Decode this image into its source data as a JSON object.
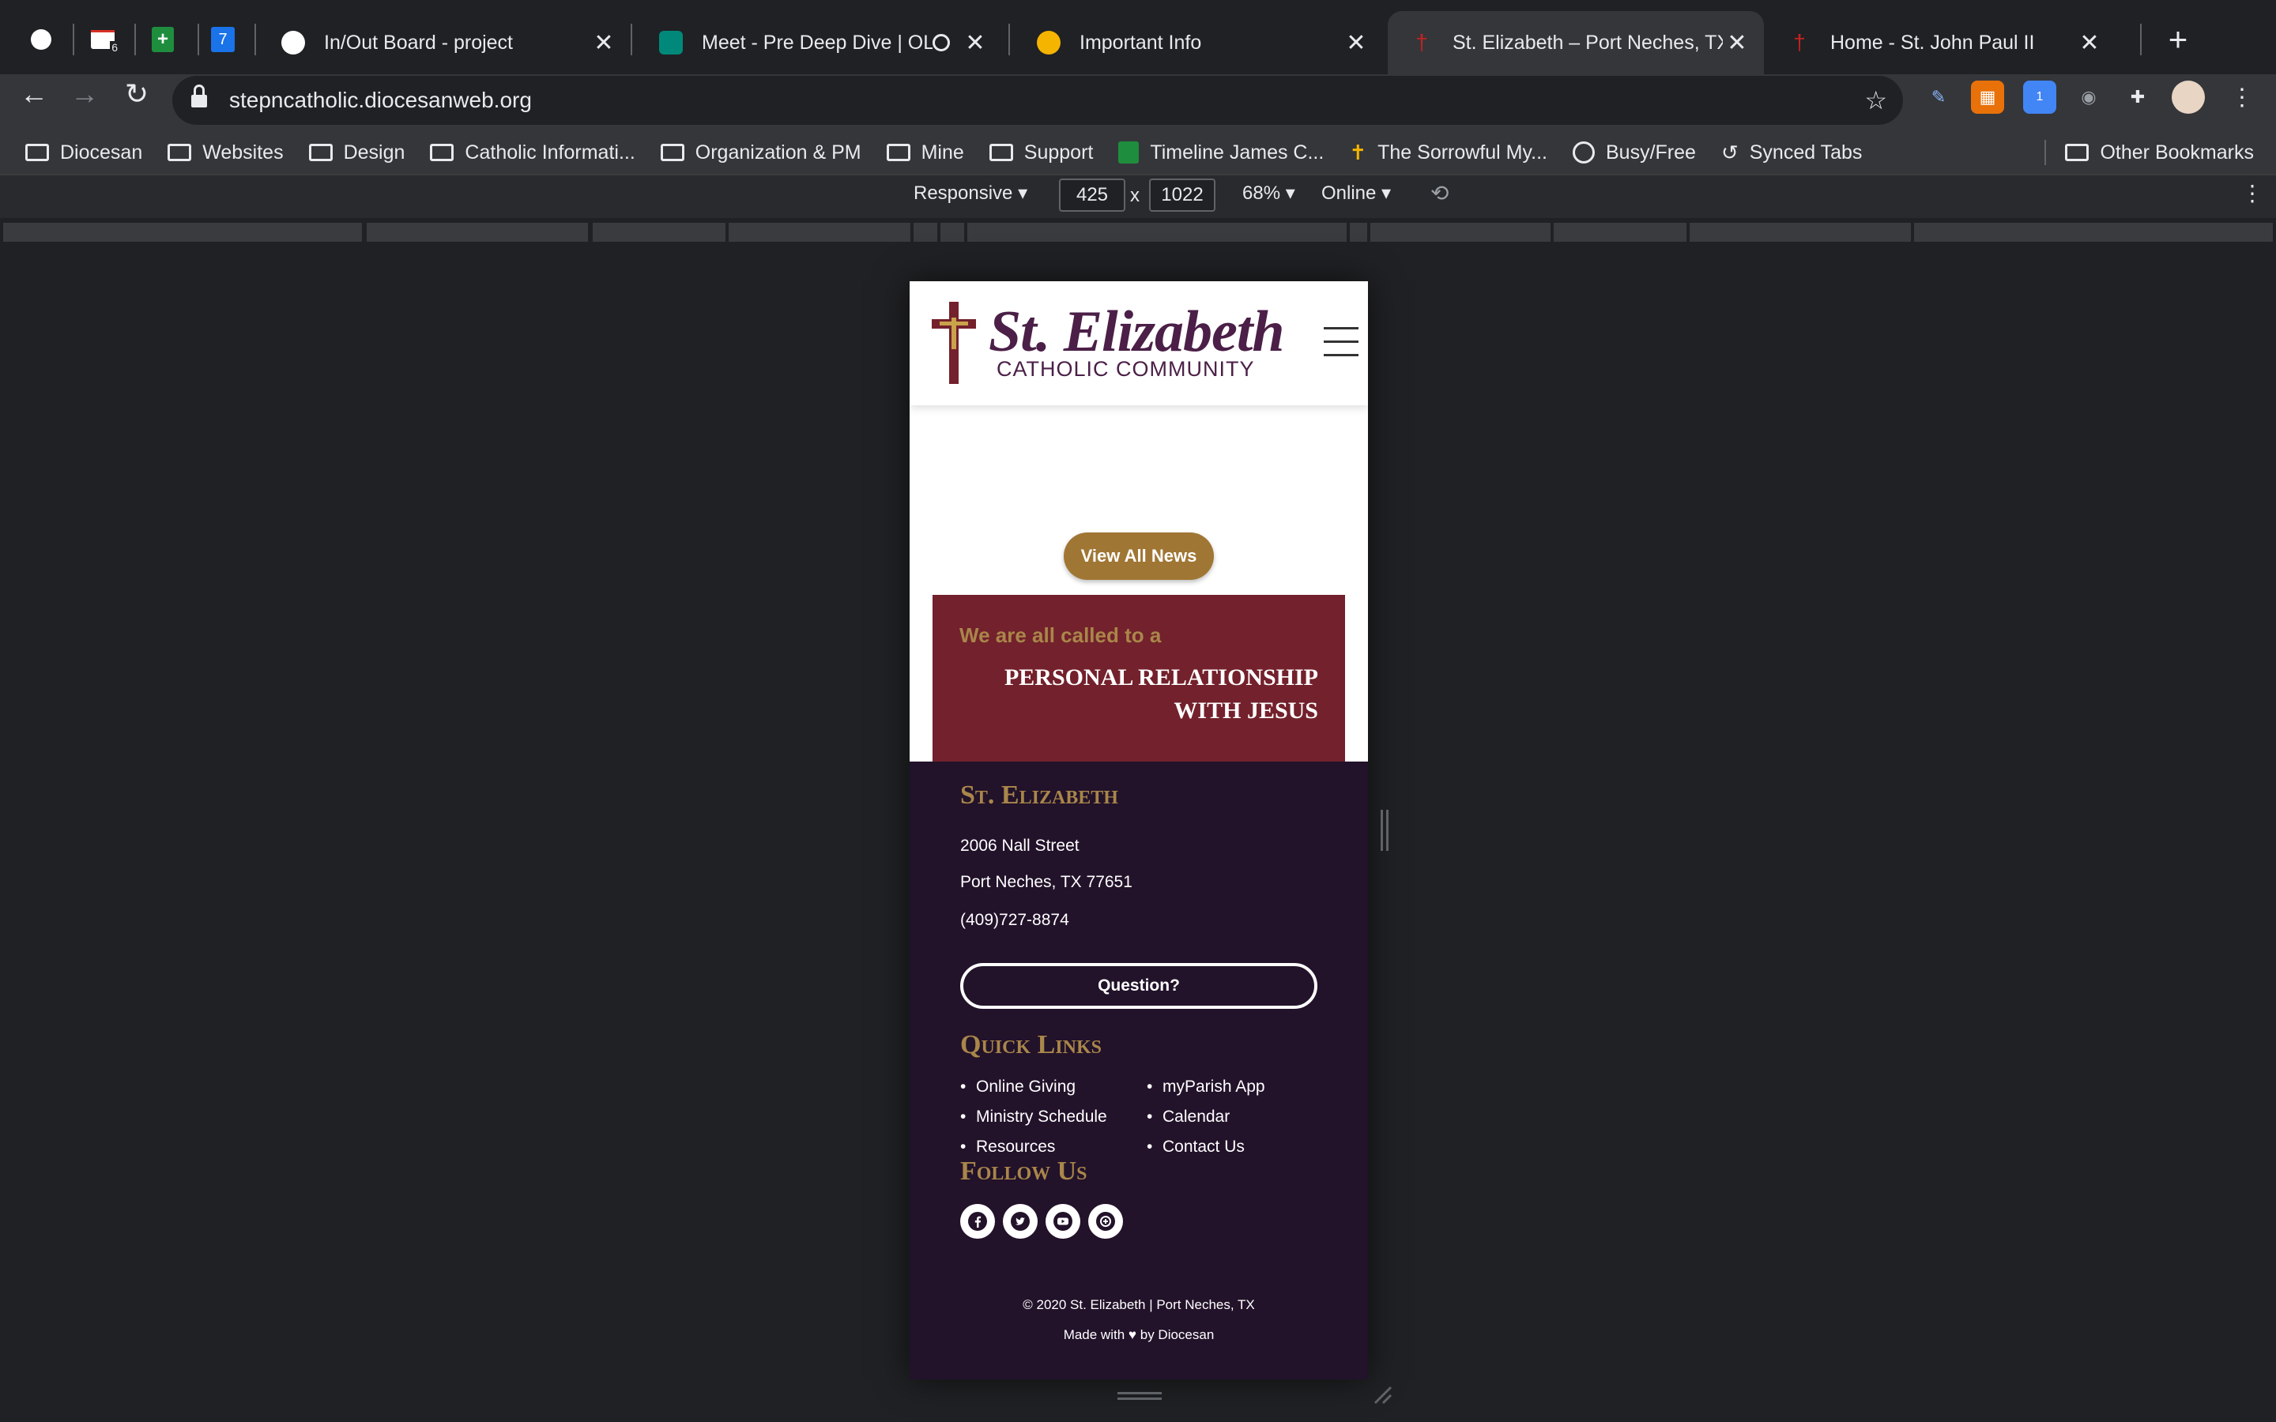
{
  "tabs": [
    {
      "title": "In/Out Board - project"
    },
    {
      "title": "Meet - Pre Deep Dive | OLG"
    },
    {
      "title": "Important Info"
    },
    {
      "title": "St. Elizabeth – Port Neches, TX"
    },
    {
      "title": "Home - St. John Paul II"
    }
  ],
  "pinned_badges": {
    "gmail": "6",
    "calendar": "7"
  },
  "omnibox": {
    "url": "stepncatholic.diocesanweb.org"
  },
  "extensions_badge": "1",
  "bookmarks": [
    {
      "label": "Diocesan",
      "icon": "folder-icon"
    },
    {
      "label": "Websites",
      "icon": "folder-icon"
    },
    {
      "label": "Design",
      "icon": "folder-icon"
    },
    {
      "label": "Catholic Informati...",
      "icon": "folder-icon"
    },
    {
      "label": "Organization & PM",
      "icon": "folder-icon"
    },
    {
      "label": "Mine",
      "icon": "folder-icon"
    },
    {
      "label": "Support",
      "icon": "folder-icon"
    },
    {
      "label": "Timeline James C...",
      "icon": "sheets-icon"
    },
    {
      "label": "The Sorrowful My...",
      "icon": "rosary-icon"
    },
    {
      "label": "Busy/Free",
      "icon": "globe-icon"
    },
    {
      "label": "Synced Tabs",
      "icon": "history-icon"
    }
  ],
  "other_bookmarks": "Other Bookmarks",
  "devtools": {
    "device": "Responsive",
    "width": "425",
    "times": "x",
    "height": "1022",
    "zoom": "68%",
    "network": "Online"
  },
  "site": {
    "logo_title": "St. Elizabeth",
    "logo_subtitle": "CATHOLIC COMMUNITY",
    "news_button": "View All News",
    "callout_pre": "We are all called to a",
    "callout_line1": "PERSONAL RELATIONSHIP",
    "callout_line2": "WITH JESUS",
    "footer": {
      "parish_heading": "St. Elizabeth",
      "address_line1": "2006 Nall Street",
      "address_line2": "Port Neches, TX 77651",
      "phone": "(409)727-8874",
      "question_button": "Question?",
      "quick_links_heading": "Quick Links",
      "quick_links": [
        "Online Giving",
        "myParish App",
        "Ministry Schedule",
        "Calendar",
        "Resources",
        "Contact Us"
      ],
      "follow_heading": "Follow Us",
      "social_icons": [
        "facebook-icon",
        "twitter-icon",
        "youtube-icon",
        "myparish-icon"
      ],
      "copyright": "© 2020 St. Elizabeth | Port Neches, TX",
      "made_with_prefix": "Made with",
      "made_with_suffix": "by Diocesan"
    }
  },
  "colors": {
    "maroon": "#73212c",
    "footer_bg": "#22122a",
    "gold": "#a9864a",
    "button_gold": "#a07634",
    "logo_purple": "#4b1f47"
  }
}
